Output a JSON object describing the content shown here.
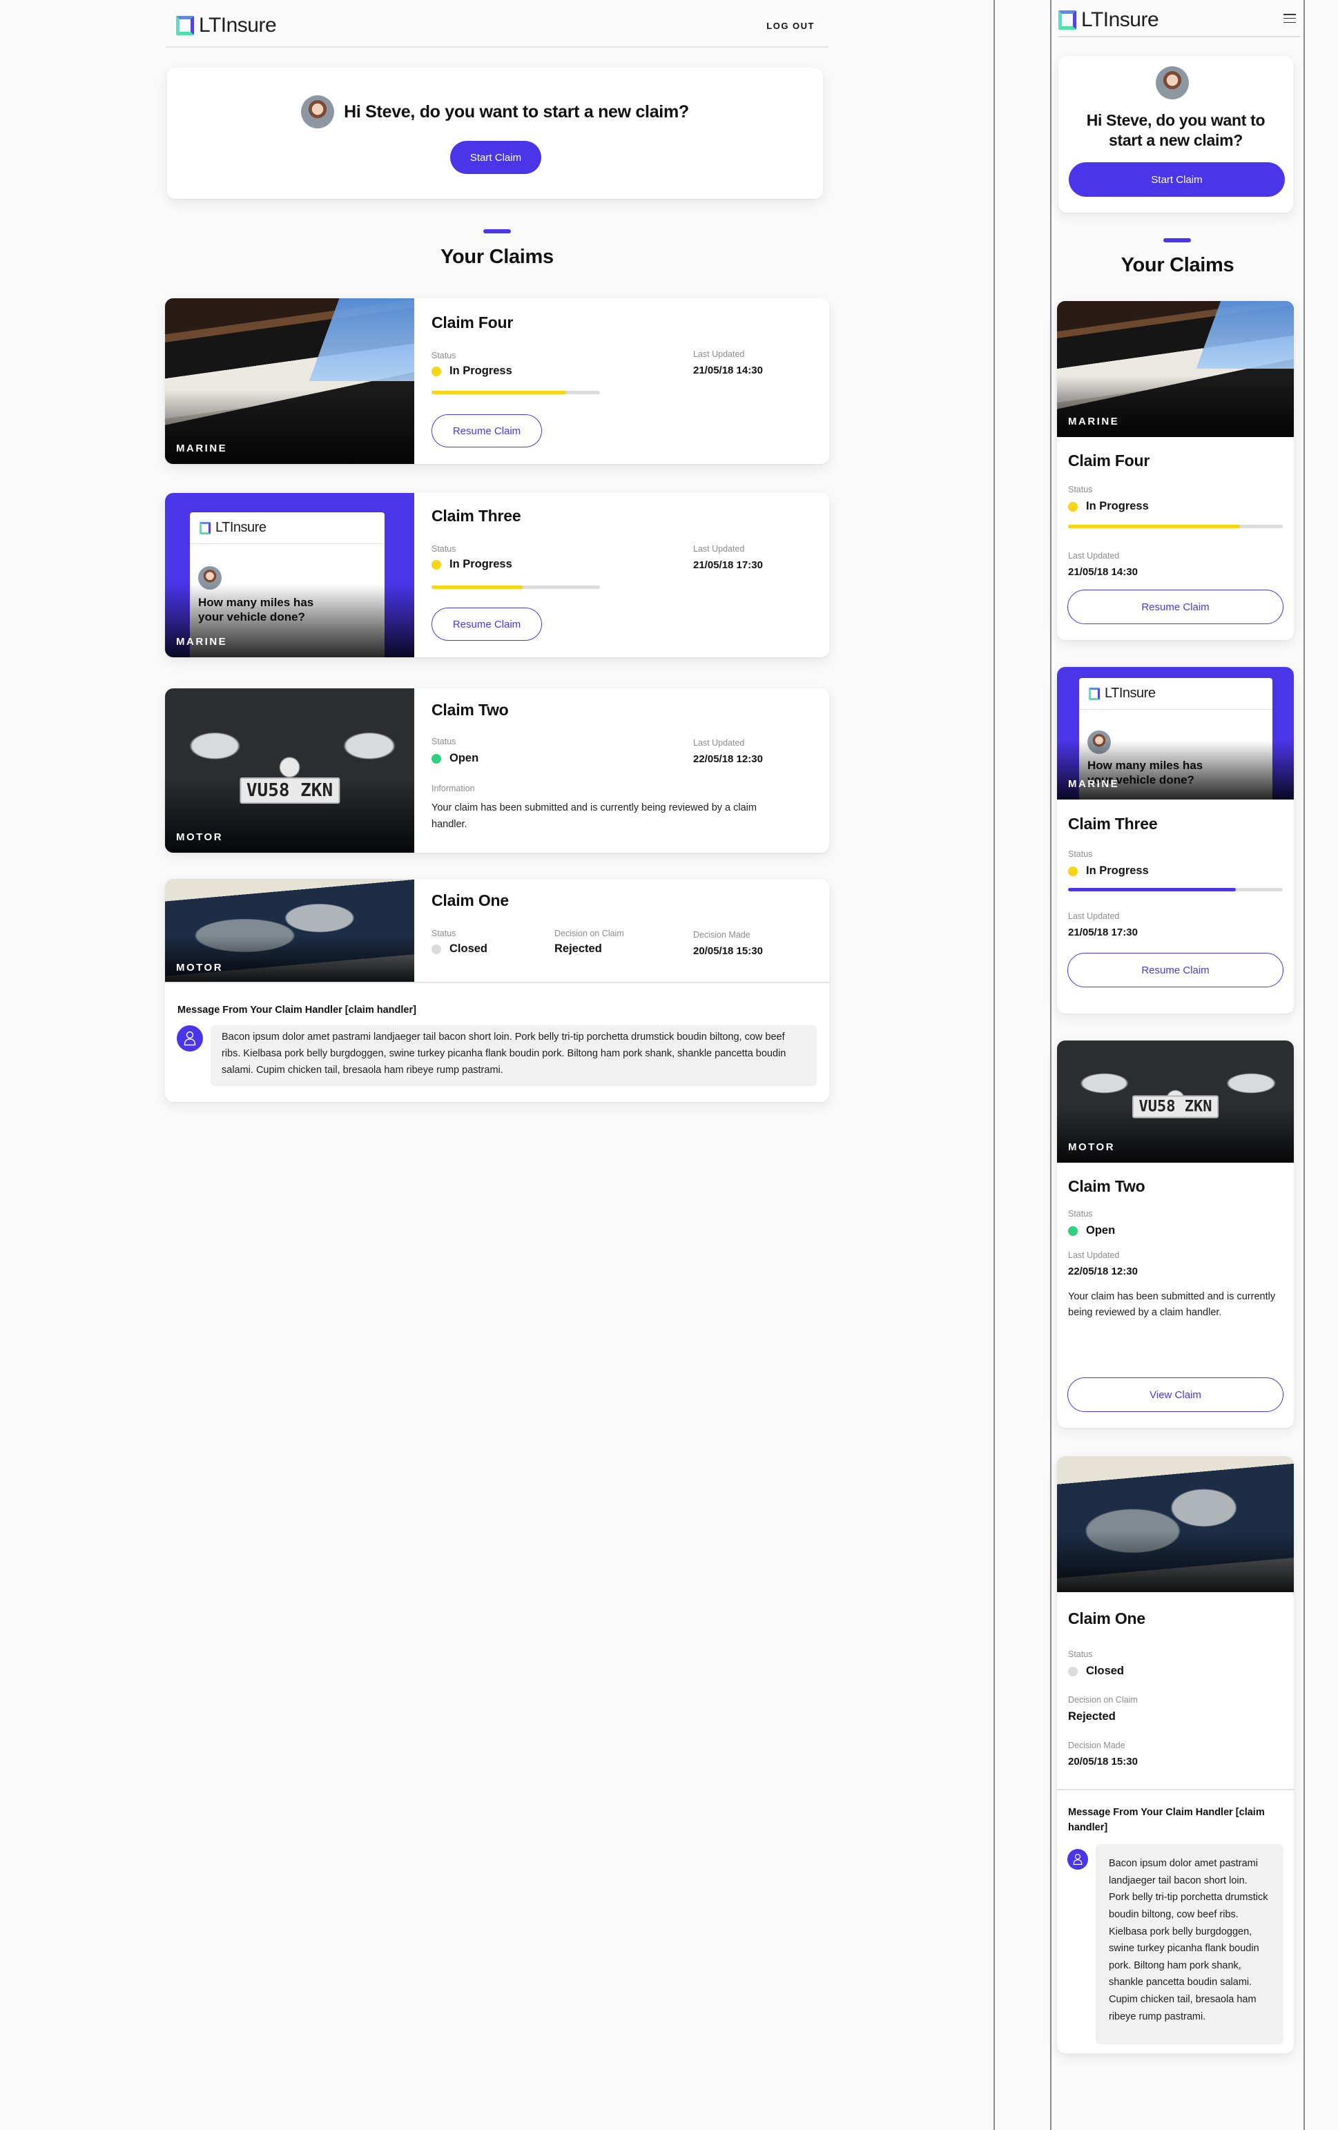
{
  "brand": {
    "name": "LTInsure",
    "colors": {
      "accent": "#4b35e8",
      "in_progress": "#f5d515",
      "open": "#2fd17d",
      "closed": "#dcdcdc",
      "logo_top": "#5b8be8",
      "logo_side": "#54e2c3"
    }
  },
  "header": {
    "logout_label": "LOG OUT",
    "menu_icon": "hamburger-icon"
  },
  "hero": {
    "greeting": "Hi Steve, do you want to start a new claim?",
    "start_button": "Start Claim"
  },
  "section": {
    "title": "Your Claims"
  },
  "labels": {
    "status": "Status",
    "last_updated": "Last Updated",
    "information": "Information",
    "decision_on_claim": "Decision on Claim",
    "decision_made": "Decision Made",
    "resume": "Resume Claim",
    "view": "View Claim"
  },
  "claims": [
    {
      "title": "Claim Four",
      "category": "MARINE",
      "image": "boat-damage-photo",
      "status": "In Progress",
      "progress": 0.8,
      "last_updated": "21/05/18 14:30"
    },
    {
      "title": "Claim Three",
      "category": "MARINE",
      "image": "app-screenshot",
      "screen_question": "How many miles has your vehicle done?",
      "status": "In Progress",
      "progress_desktop": 0.54,
      "progress_mobile": 0.78,
      "last_updated": "21/05/18 17:30"
    },
    {
      "title": "Claim Two",
      "category": "MOTOR",
      "image": "car-front-photo",
      "plate": "VU58 ZKN",
      "status": "Open",
      "last_updated": "22/05/18 12:30",
      "information": "Your claim has been submitted and is currently being reviewed by a claim handler."
    },
    {
      "title": "Claim One",
      "category": "MOTOR",
      "image": "crashed-car-photo",
      "status": "Closed",
      "decision": "Rejected",
      "decision_made": "20/05/18 15:30",
      "message": {
        "title": "Message From Your Claim Handler [claim handler]",
        "body": "Bacon ipsum dolor amet pastrami landjaeger tail bacon short loin. Pork belly tri-tip porchetta drumstick boudin biltong, cow beef ribs. Kielbasa pork belly burgdoggen, swine turkey picanha flank boudin pork. Biltong ham pork shank, shankle pancetta boudin salami. Cupim chicken tail, bresaola ham ribeye rump pastrami."
      }
    }
  ]
}
